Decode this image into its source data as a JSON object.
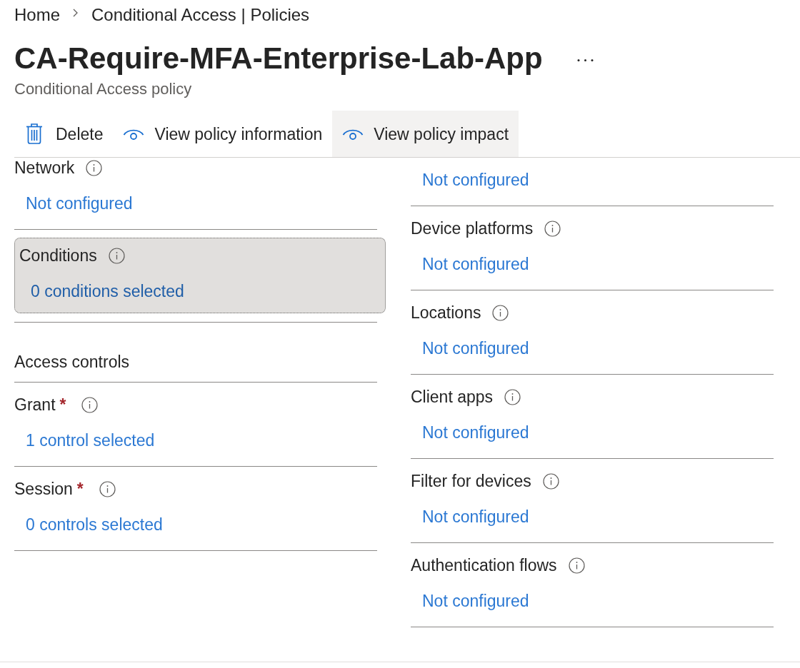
{
  "breadcrumb": [
    {
      "label": "Home"
    },
    {
      "label": "Conditional Access | Policies"
    }
  ],
  "header": {
    "title": "CA-Require-MFA-Enterprise-Lab-App",
    "subtitle": "Conditional Access policy"
  },
  "toolbar": [
    {
      "kind": "delete",
      "label": "Delete",
      "highlighted": false
    },
    {
      "kind": "view",
      "label": "View policy information",
      "highlighted": false
    },
    {
      "kind": "view",
      "label": "View policy impact",
      "highlighted": true
    }
  ],
  "left_column": {
    "sections": [
      {
        "label": "Network",
        "value": "Not configured",
        "focused": false
      },
      {
        "label": "Conditions",
        "value": "0 conditions selected",
        "focused": true
      }
    ]
  },
  "access_controls": {
    "heading": "Access controls",
    "sections": [
      {
        "label": "Grant",
        "required_mark": "*",
        "value": "1 control selected",
        "focused": false
      },
      {
        "label": "Session",
        "required_mark": "*",
        "value": "0 controls selected",
        "focused": false
      }
    ]
  },
  "right_column": {
    "sections": [
      {
        "value": "Not configured",
        "focused": false
      },
      {
        "label": "Device platforms",
        "value": "Not configured",
        "focused": false
      },
      {
        "label": "Locations",
        "value": "Not configured",
        "focused": false
      },
      {
        "label": "Client apps",
        "value": "Not configured",
        "focused": false
      },
      {
        "label": "Filter for devices",
        "value": "Not configured",
        "focused": false
      },
      {
        "label": "Authentication flows",
        "value": "Not configured",
        "focused": false
      }
    ]
  }
}
